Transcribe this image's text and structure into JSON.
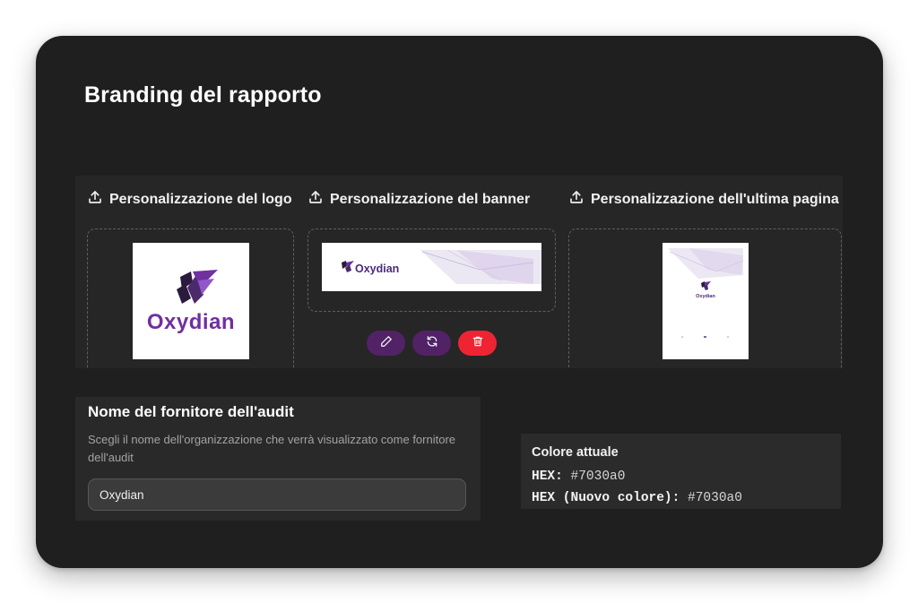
{
  "page": {
    "title": "Branding del rapporto"
  },
  "sections": {
    "logo": {
      "label": "Personalizzazione del logo",
      "brand": "Oxydian"
    },
    "banner": {
      "label": "Personalizzazione del banner",
      "brand": "Oxydian"
    },
    "last_page": {
      "label": "Personalizzazione dell'ultima pagina",
      "brand": "Oxydian"
    }
  },
  "banner_actions": [
    "pencil-icon",
    "refresh-icon",
    "trash-icon"
  ],
  "provider": {
    "title": "Nome del fornitore dell'audit",
    "description": "Scegli il nome dell'organizzazione che verrà visualizzato come fornitore dell'audit",
    "value": "Oxydian"
  },
  "color": {
    "title": "Colore attuale",
    "hex_label": "HEX:",
    "hex_value": "#7030a0",
    "new_label": "HEX (Nuovo colore):",
    "new_value": "#7030a0"
  },
  "colors": {
    "brand": "#7030a0",
    "panel_dark": "#1f1f1f",
    "action_purple": "#522267",
    "danger_red": "#ef2433"
  }
}
